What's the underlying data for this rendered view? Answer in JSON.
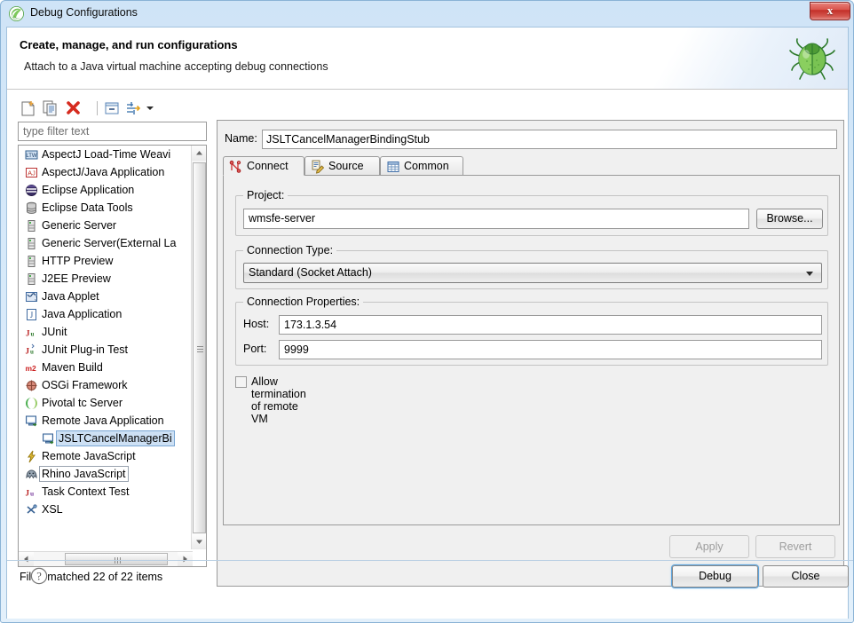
{
  "window": {
    "title": "Debug Configurations",
    "title_icon": "eclipse-icon",
    "close_glyph": "x"
  },
  "banner": {
    "title": "Create, manage, and run configurations",
    "subtitle": "Attach to a Java virtual machine accepting debug connections",
    "icon": "bug-icon"
  },
  "toolbar": {
    "buttons": [
      {
        "name": "new-launch-configuration-icon",
        "title": "New launch configuration"
      },
      {
        "name": "duplicate-icon",
        "title": "Duplicate"
      },
      {
        "name": "delete-icon",
        "title": "Delete"
      },
      {
        "name": "collapse-all-icon",
        "title": "Collapse All"
      },
      {
        "name": "filter-icon",
        "title": "Filter launch configurations"
      }
    ],
    "menu_arrow": "chevron-down-icon"
  },
  "filter": {
    "placeholder": "type filter text",
    "value": "",
    "status": "Filter matched 22 of 22 items"
  },
  "tree": {
    "items": [
      {
        "label": "AspectJ Load-Time Weavi",
        "icon": "ltw-icon",
        "indent": 0,
        "state": ""
      },
      {
        "label": "AspectJ/Java Application",
        "icon": "aj-icon",
        "indent": 0,
        "state": ""
      },
      {
        "label": "Eclipse Application",
        "icon": "eclipse-app-icon",
        "indent": 0,
        "state": ""
      },
      {
        "label": "Eclipse Data Tools",
        "icon": "database-icon",
        "indent": 0,
        "state": ""
      },
      {
        "label": "Generic Server",
        "icon": "server-icon",
        "indent": 0,
        "state": ""
      },
      {
        "label": "Generic Server(External La",
        "icon": "server-icon",
        "indent": 0,
        "state": ""
      },
      {
        "label": "HTTP Preview",
        "icon": "server-icon",
        "indent": 0,
        "state": ""
      },
      {
        "label": "J2EE Preview",
        "icon": "server-icon",
        "indent": 0,
        "state": ""
      },
      {
        "label": "Java Applet",
        "icon": "applet-icon",
        "indent": 0,
        "state": ""
      },
      {
        "label": "Java Application",
        "icon": "java-icon",
        "indent": 0,
        "state": ""
      },
      {
        "label": "JUnit",
        "icon": "junit-icon",
        "indent": 0,
        "state": ""
      },
      {
        "label": "JUnit Plug-in Test",
        "icon": "junit-plugin-icon",
        "indent": 0,
        "state": ""
      },
      {
        "label": "Maven Build",
        "icon": "maven-icon",
        "indent": 0,
        "state": ""
      },
      {
        "label": "OSGi Framework",
        "icon": "osgi-icon",
        "indent": 0,
        "state": ""
      },
      {
        "label": "Pivotal tc Server",
        "icon": "pivotal-icon",
        "indent": 0,
        "state": ""
      },
      {
        "label": "Remote Java Application",
        "icon": "remote-java-icon",
        "indent": 0,
        "state": "expanded"
      },
      {
        "label": "JSLTCancelManagerBi",
        "icon": "remote-java-icon",
        "indent": 1,
        "state": "selected"
      },
      {
        "label": "Remote JavaScript",
        "icon": "remote-js-icon",
        "indent": 0,
        "state": ""
      },
      {
        "label": "Rhino JavaScript",
        "icon": "rhino-icon",
        "indent": 0,
        "state": "focused"
      },
      {
        "label": "Task Context Test",
        "icon": "task-test-icon",
        "indent": 0,
        "state": ""
      },
      {
        "label": "XSL",
        "icon": "xsl-icon",
        "indent": 0,
        "state": ""
      }
    ]
  },
  "config": {
    "name_label": "Name:",
    "name_value": "JSLTCancelManagerBindingStub",
    "tabs": [
      {
        "label": "Connect",
        "icon": "connect-icon",
        "active": true
      },
      {
        "label": "Source",
        "icon": "source-icon",
        "active": false
      },
      {
        "label": "Common",
        "icon": "common-icon",
        "active": false
      }
    ],
    "project": {
      "group_label": "Project:",
      "value": "wmsfe-server",
      "browse_label": "Browse..."
    },
    "connection_type": {
      "group_label": "Connection Type:",
      "selected": "Standard (Socket Attach)"
    },
    "connection_properties": {
      "group_label": "Connection Properties:",
      "host_label": "Host:",
      "host_value": "173.1.3.54",
      "port_label": "Port:",
      "port_value": "9999"
    },
    "allow_termination": {
      "label": "Allow termination of remote VM",
      "checked": false
    },
    "apply_label": "Apply",
    "revert_label": "Revert"
  },
  "footer": {
    "help_icon": "help-icon",
    "debug_label": "Debug",
    "close_label": "Close"
  },
  "colors": {
    "titlebar_blue": "#cfe4f7",
    "selection_blue": "#cde0f4",
    "close_red": "#c32f28",
    "accent_focus": "#5ba3dd",
    "disabled_text": "#9d9d9d"
  }
}
